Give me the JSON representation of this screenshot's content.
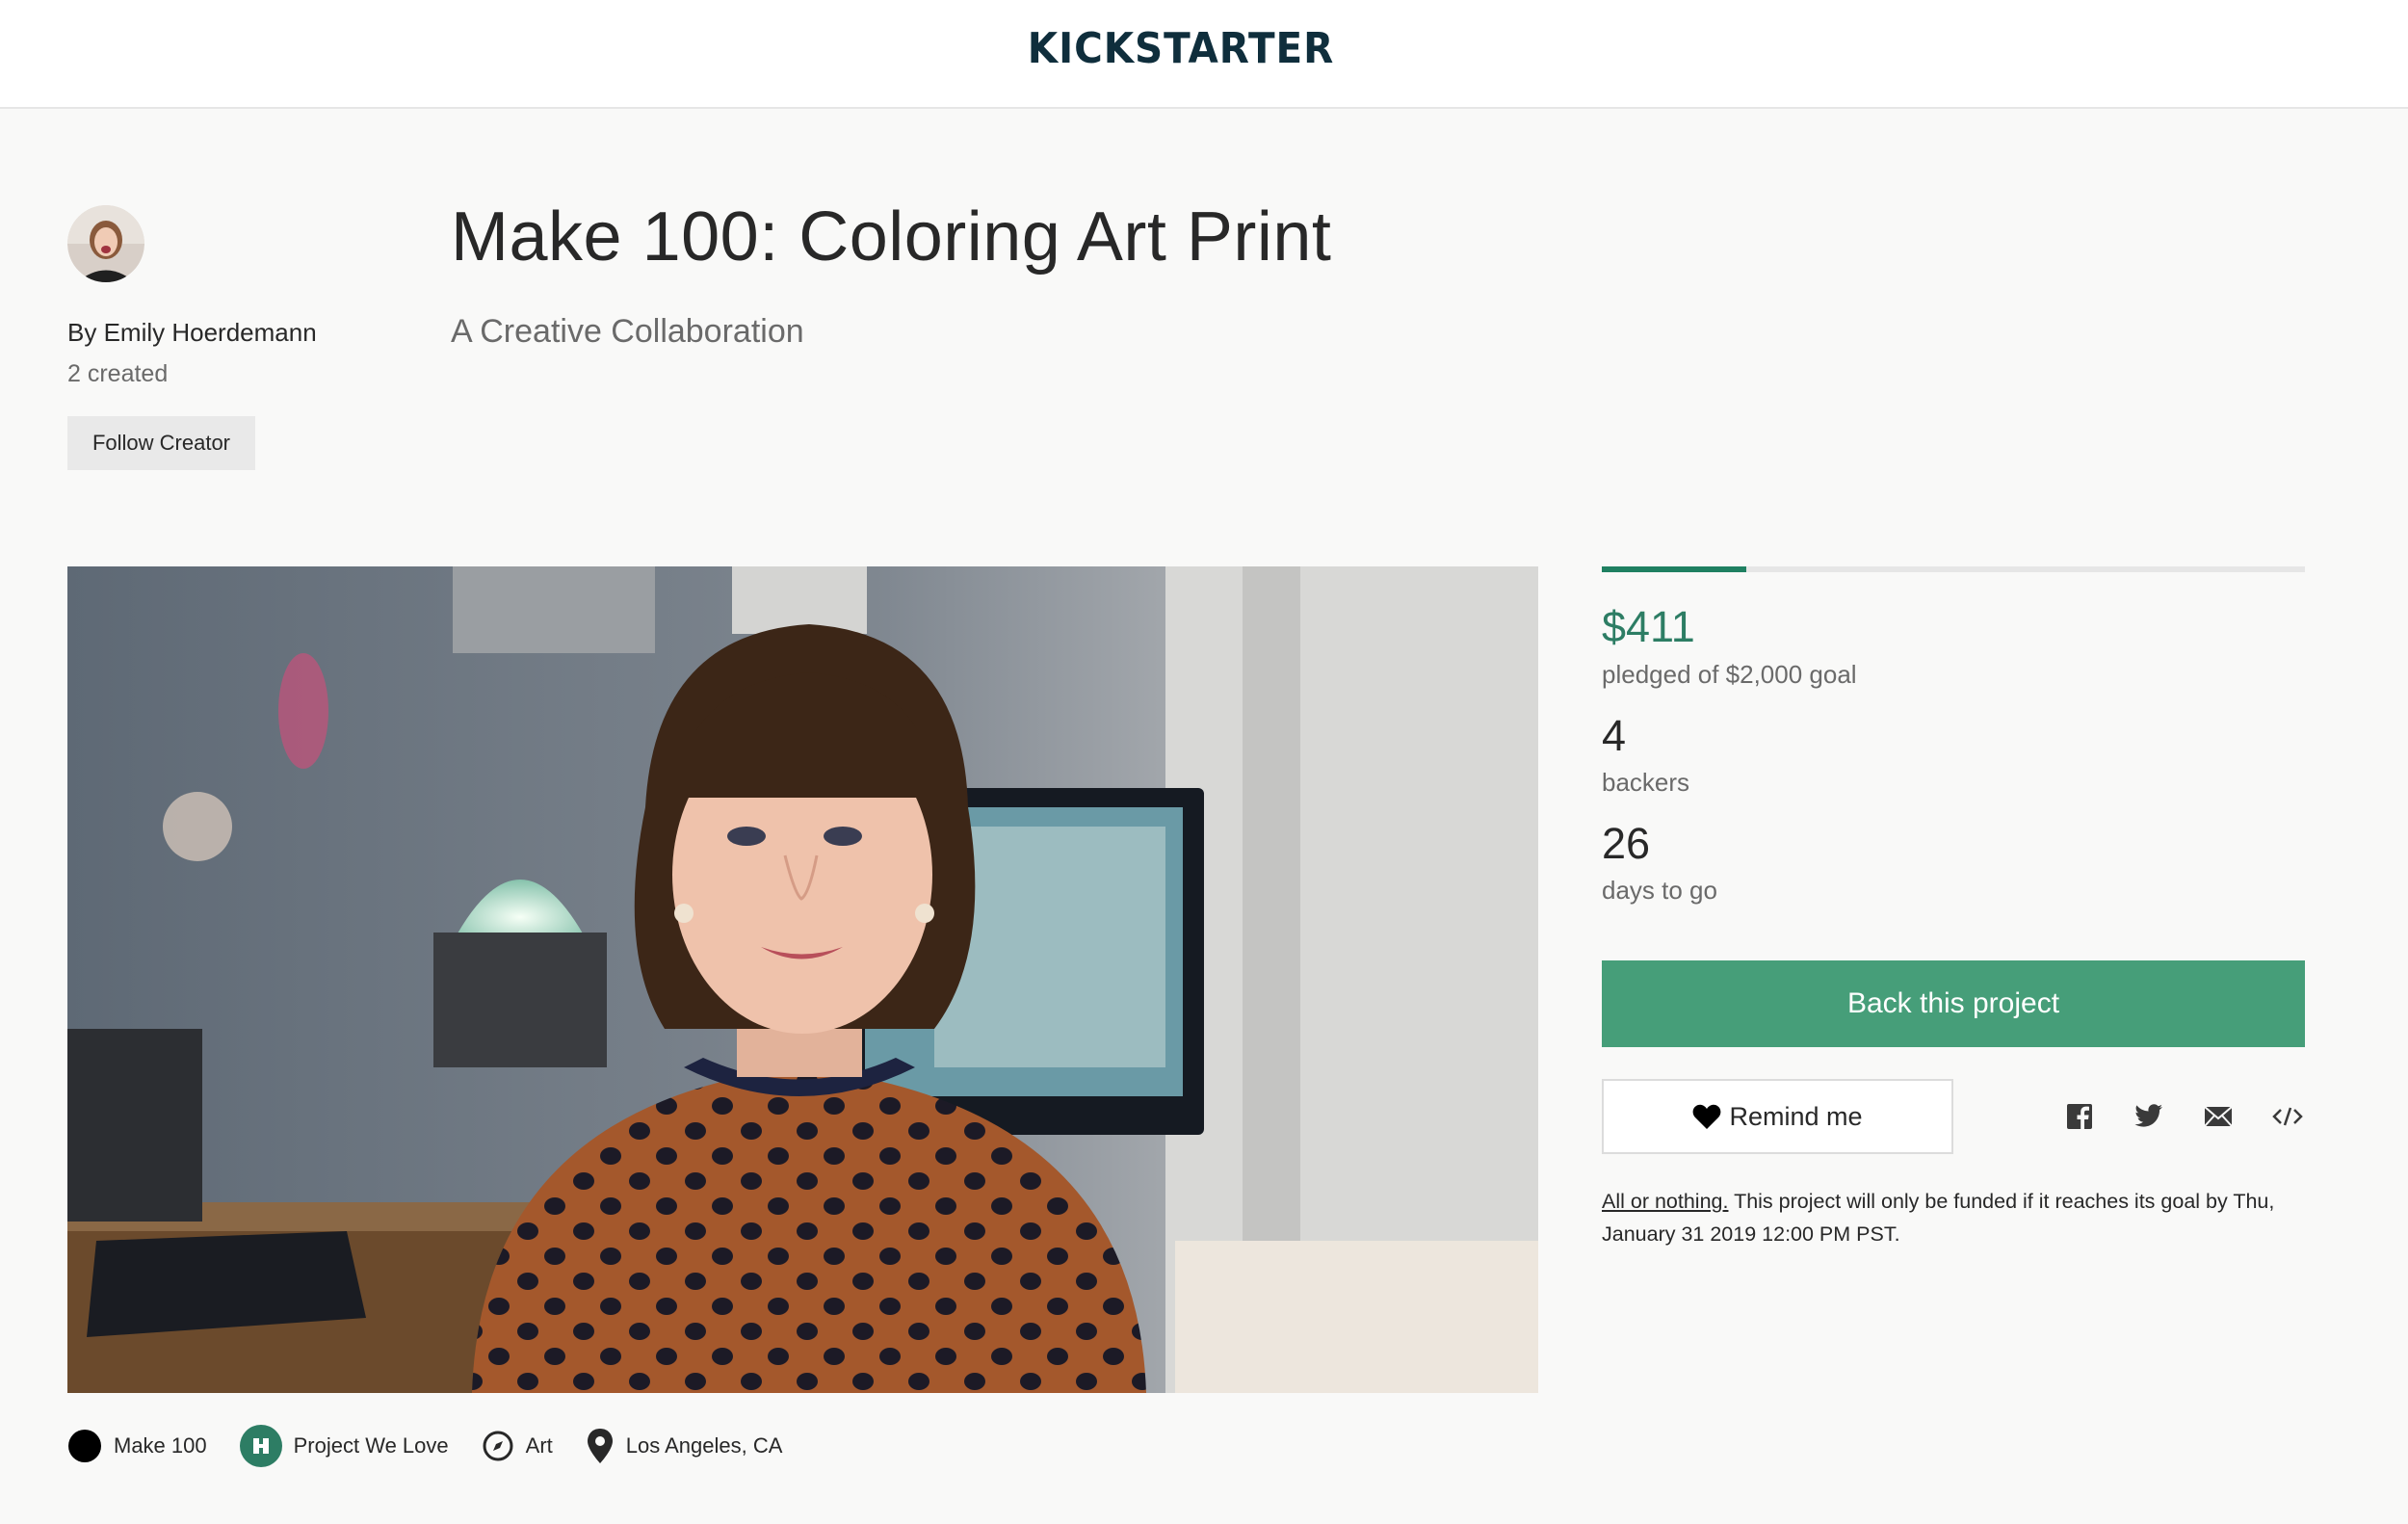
{
  "header": {
    "logo_text": "KICKSTARTER"
  },
  "creator": {
    "byline": "By Emily Hoerdemann",
    "created": "2 created",
    "follow_label": "Follow Creator"
  },
  "project": {
    "title": "Make 100: Coloring Art Print",
    "subtitle": "A Creative Collaboration"
  },
  "stats": {
    "funded_fraction": 0.2055,
    "pledged": "$411",
    "pledged_label": "pledged of $2,000 goal",
    "backers": "4",
    "backers_label": "backers",
    "days": "26",
    "days_label": "days to go"
  },
  "actions": {
    "back_label": "Back this project",
    "remind_label": "Remind me",
    "share_icons": [
      "facebook-icon",
      "twitter-icon",
      "email-icon",
      "embed-icon"
    ]
  },
  "fine_print": {
    "all_or_nothing": "All or nothing.",
    "text": "This project will only be funded if it reaches its goal by Thu, January 31 2019 12:00 PM PST."
  },
  "tags": [
    {
      "icon": "make100-icon",
      "label": "Make 100"
    },
    {
      "icon": "project-we-love-icon",
      "label": "Project We Love"
    },
    {
      "icon": "compass-icon",
      "label": "Art"
    },
    {
      "icon": "location-pin-icon",
      "label": "Los Angeles, CA"
    }
  ],
  "colors": {
    "accent": "#2d7d64",
    "button": "#469e79",
    "progress": "#1f8061",
    "logo": "#0f2e3c"
  }
}
